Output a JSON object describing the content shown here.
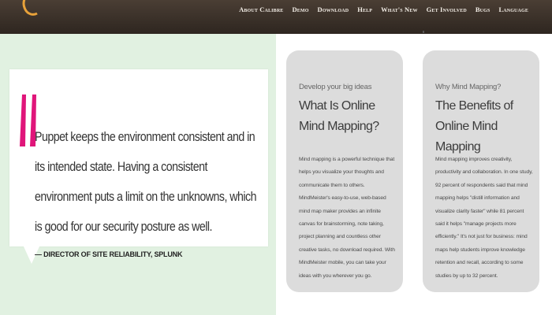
{
  "header": {
    "logo_tagline": "",
    "nav_items": [
      "About Calibre",
      "Demo",
      "Download",
      "Help",
      "What's New",
      "Get Involved",
      "Bugs",
      "Language"
    ]
  },
  "testimonial": {
    "quote": "Puppet keeps the environment consistent and in its intended state. Having a consistent environment puts a limit on the unknowns, which is good for our security posture as well.",
    "author": "— DIRECTOR OF SITE RELIABILITY, SPLUNK"
  },
  "cards": [
    {
      "kicker": "Develop your big ideas",
      "title": "What Is Online Mind Mapping?",
      "body": "Mind mapping is a powerful technique that helps you visualize your thoughts and communicate them to others. MindMeister's easy-to-use, web-based mind map maker provides an infinite canvas for brainstorming, note taking, project planning and countless other creative tasks, no download required. With MindMeister mobile, you can take your ideas with you wherever you go."
    },
    {
      "kicker": "Why Mind Mapping?",
      "title": "The Benefits of Online Mind Mapping",
      "body": "Mind mapping improves creativity, productivity and collaboration. In one study, 92 percent of respondents said that mind mapping helps \"distill information and visualize clarity faster\" while 81 percent said it helps \"manage projects more efficiently.\" It's not just for business: mind maps help students improve knowledge retention and recall, according to some studies by up to 32 percent."
    }
  ],
  "colors": {
    "header_bg": "#3a3029",
    "left_panel_bg": "#e1f1e1",
    "card_bg": "#dcdcdc",
    "quote_mark": "#e0157a"
  }
}
